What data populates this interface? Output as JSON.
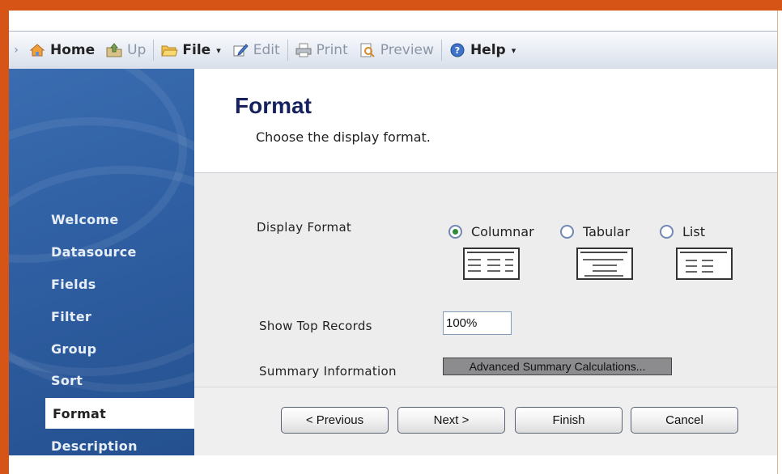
{
  "toolbar": {
    "lead": "›",
    "items": [
      {
        "label": "Home",
        "icon": "home-icon"
      },
      {
        "label": "Up",
        "icon": "up-folder-icon"
      },
      {
        "label": "File",
        "icon": "folder-icon"
      },
      {
        "label": "Edit",
        "icon": "edit-icon"
      },
      {
        "label": "Print",
        "icon": "print-icon"
      },
      {
        "label": "Preview",
        "icon": "preview-icon"
      },
      {
        "label": "Help",
        "icon": "help-icon"
      }
    ],
    "caret": "▾"
  },
  "sidebar": {
    "items": [
      {
        "label": "Welcome"
      },
      {
        "label": "Datasource"
      },
      {
        "label": "Fields"
      },
      {
        "label": "Filter"
      },
      {
        "label": "Group"
      },
      {
        "label": "Sort"
      },
      {
        "label": "Format",
        "active": true
      },
      {
        "label": "Description"
      }
    ]
  },
  "header": {
    "title": "Format",
    "subtitle": "Choose the display format."
  },
  "form": {
    "display_format_label": "Display Format",
    "options": [
      {
        "label": "Columnar",
        "checked": true
      },
      {
        "label": "Tabular",
        "checked": false
      },
      {
        "label": "List",
        "checked": false
      }
    ],
    "show_top_records_label": "Show Top Records",
    "show_top_records_value": "100%",
    "summary_label": "Summary Information",
    "advanced_button": "Advanced Summary Calculations..."
  },
  "footer": {
    "previous": "< Previous",
    "next": "Next >",
    "finish": "Finish",
    "cancel": "Cancel"
  },
  "colors": {
    "frame": "#d75417",
    "sidebar": "#2f5fa2",
    "title": "#17215e",
    "radio_checked": "#2f8a3b"
  }
}
